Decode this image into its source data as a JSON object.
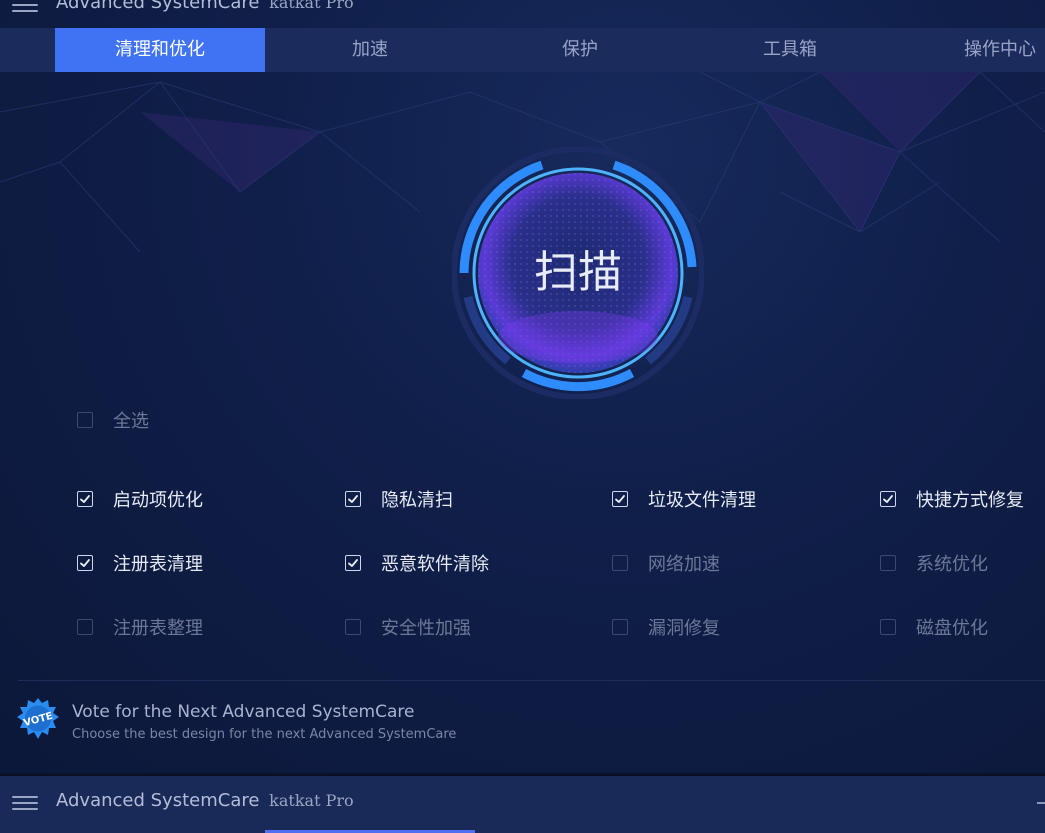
{
  "app": {
    "title": "Advanced SystemCare",
    "edition": "katkat Pro"
  },
  "tabs": [
    {
      "label": "清理和优化",
      "active": true
    },
    {
      "label": "加速",
      "active": false
    },
    {
      "label": "保护",
      "active": false
    },
    {
      "label": "工具箱",
      "active": false
    },
    {
      "label": "操作中心",
      "active": false
    }
  ],
  "scan": {
    "label": "扫描"
  },
  "select_all": {
    "label": "全选",
    "checked": false
  },
  "options": [
    {
      "label": "启动项优化",
      "checked": true
    },
    {
      "label": "隐私清扫",
      "checked": true
    },
    {
      "label": "垃圾文件清理",
      "checked": true
    },
    {
      "label": "快捷方式修复",
      "checked": true
    },
    {
      "label": "注册表清理",
      "checked": true
    },
    {
      "label": "恶意软件清除",
      "checked": true
    },
    {
      "label": "网络加速",
      "checked": false
    },
    {
      "label": "系统优化",
      "checked": false
    },
    {
      "label": "注册表整理",
      "checked": false
    },
    {
      "label": "安全性加强",
      "checked": false
    },
    {
      "label": "漏洞修复",
      "checked": false
    },
    {
      "label": "磁盘优化",
      "checked": false
    }
  ],
  "vote": {
    "badge": "VOTE",
    "title": "Vote for the Next Advanced SystemCare",
    "subtitle": "Choose the best design for the next Advanced SystemCare"
  },
  "colors": {
    "accent": "#3f73f3",
    "background": "#101f4a",
    "ring": "#1e9bff"
  }
}
